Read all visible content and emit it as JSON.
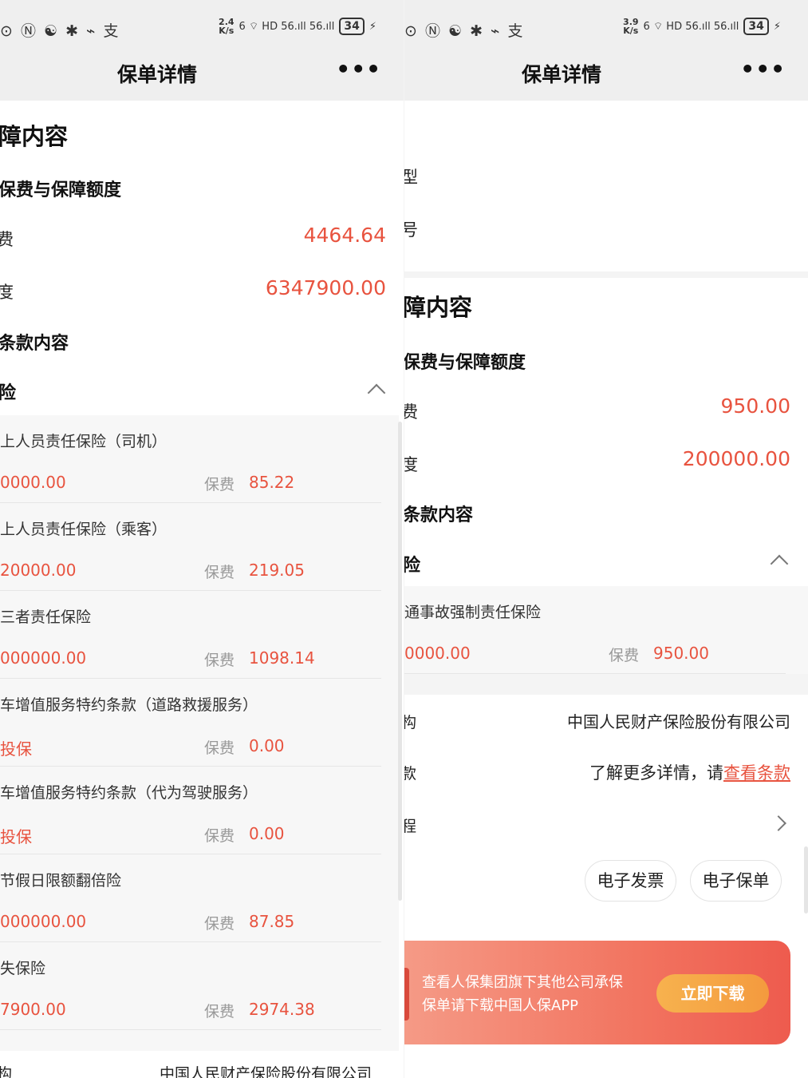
{
  "left": {
    "status": {
      "icons": "⊙ Ⓝ ☯ ✱ ⌁ 支",
      "speed_top": "2.4",
      "speed_bottom": "K/s",
      "net": "6 ⌔ HD 56.ıll 56.ıll",
      "battery": "34",
      "charge": "⚡"
    },
    "nav": {
      "title": "保单详情",
      "more": "•••"
    },
    "section_title": "障内容",
    "premium_title": "保费与保障额度",
    "premium_rows": [
      {
        "label": "费",
        "value": "4464.64"
      },
      {
        "label": "度",
        "value": "6347900.00"
      }
    ],
    "clause_title": "条款内容",
    "insurance_title": "险",
    "coverages": [
      {
        "name": "上人员责任保险（司机）",
        "amount": "0000.00",
        "fee_label": "保费",
        "fee": "85.22"
      },
      {
        "name": "上人员责任保险（乘客）",
        "amount": "20000.00",
        "fee_label": "保费",
        "fee": "219.05"
      },
      {
        "name": "三者责任保险",
        "amount": "000000.00",
        "fee_label": "保费",
        "fee": "1098.14"
      },
      {
        "name": "车增值服务特约条款（道路救援服务）",
        "amount": "投保",
        "fee_label": "保费",
        "fee": "0.00"
      },
      {
        "name": "车增值服务特约条款（代为驾驶服务）",
        "amount": "投保",
        "fee_label": "保费",
        "fee": "0.00"
      },
      {
        "name": "节假日限额翻倍险",
        "amount": "000000.00",
        "fee_label": "保费",
        "fee": "87.85"
      },
      {
        "name": "失保险",
        "amount": "7900.00",
        "fee_label": "保费",
        "fee": "2974.38"
      }
    ],
    "company_label": "构",
    "company_value": "中国人民财产保险股份有限公司"
  },
  "right": {
    "status": {
      "icons": "⊙ Ⓝ ☯ ✱ ⌁ 支",
      "speed_top": "3.9",
      "speed_bottom": "K/s",
      "net": "6 ⌔ HD 56.ıll 56.ıll",
      "battery": "34",
      "charge": "⚡"
    },
    "nav": {
      "title": "保单详情",
      "more": "•••"
    },
    "top_rows": [
      "型",
      "号"
    ],
    "section_title": "障内容",
    "premium_title": "保费与保障额度",
    "premium_rows": [
      {
        "label": "费",
        "value": "950.00"
      },
      {
        "label": "度",
        "value": "200000.00"
      }
    ],
    "clause_title": "条款内容",
    "insurance_title": "险",
    "coverages": [
      {
        "name": "通事故强制责任保险",
        "amount": "0000.00",
        "fee_label": "保费",
        "fee": "950.00"
      }
    ],
    "company_label": "构",
    "company_value": "中国人民财产保险股份有限公司",
    "terms_label": "款",
    "terms_text": "了解更多详情，请",
    "terms_link": "查看条款",
    "process_label": "程",
    "buttons": {
      "invoice": "电子发票",
      "policy": "电子保单"
    },
    "banner": {
      "line1": "查看人保集团旗下其他公司承保",
      "line2": "保单请下载中国人保APP",
      "button": "立即下载"
    }
  }
}
